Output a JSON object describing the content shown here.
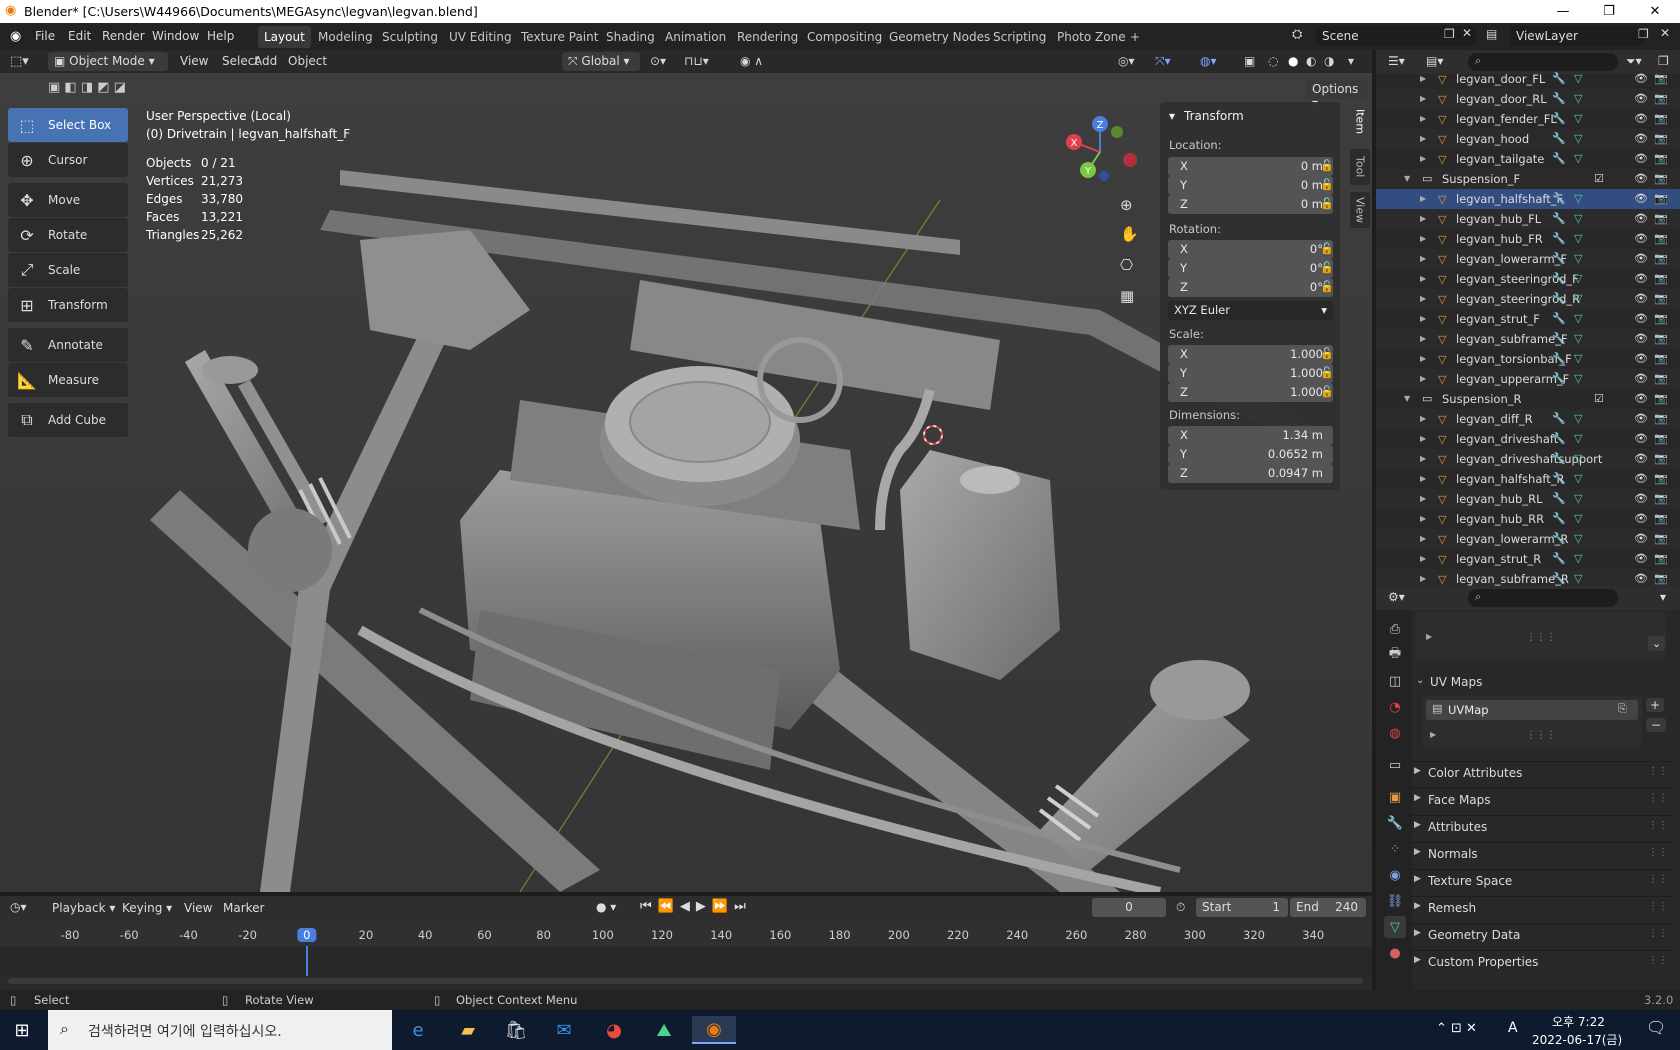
{
  "window": {
    "title": "Blender* [C:\\Users\\W44966\\Documents\\MEGAsync\\legvan\\legvan.blend]",
    "minimize": "—",
    "maximize": "❐",
    "close": "✕"
  },
  "menu": [
    "File",
    "Edit",
    "Render",
    "Window",
    "Help"
  ],
  "workspaces": [
    "Layout",
    "Modeling",
    "Sculpting",
    "UV Editing",
    "Texture Paint",
    "Shading",
    "Animation",
    "Rendering",
    "Compositing",
    "Geometry Nodes",
    "Scripting",
    "Photo Zone",
    "+"
  ],
  "active_workspace": "Layout",
  "scene": "Scene",
  "view_layer": "ViewLayer",
  "viewport_header": {
    "mode": "Object Mode",
    "menus": [
      "View",
      "Select",
      "Add",
      "Object"
    ],
    "orientation": "Global",
    "options": "Options"
  },
  "tools": [
    {
      "label": "Select Box",
      "icon": "select-box-icon",
      "glyph": "⬚",
      "active": true
    },
    {
      "label": "Cursor",
      "icon": "cursor-icon",
      "glyph": "⊕"
    },
    {
      "label": "Move",
      "icon": "move-icon",
      "glyph": "✥"
    },
    {
      "label": "Rotate",
      "icon": "rotate-icon",
      "glyph": "⟳"
    },
    {
      "label": "Scale",
      "icon": "scale-icon",
      "glyph": "⤢"
    },
    {
      "label": "Transform",
      "icon": "transform-icon",
      "glyph": "⊞"
    },
    {
      "label": "Annotate",
      "icon": "annotate-icon",
      "glyph": "✎"
    },
    {
      "label": "Measure",
      "icon": "measure-icon",
      "glyph": "📐"
    },
    {
      "label": "Add Cube",
      "icon": "add-cube-icon",
      "glyph": "⧉"
    }
  ],
  "overlay": {
    "perspective": "User Perspective (Local)",
    "context": "(0) Drivetrain | legvan_halfshaft_F",
    "stats": [
      {
        "label": "Objects",
        "value": "0 / 21"
      },
      {
        "label": "Vertices",
        "value": "21,273"
      },
      {
        "label": "Edges",
        "value": "33,780"
      },
      {
        "label": "Faces",
        "value": "13,221"
      },
      {
        "label": "Triangles",
        "value": "25,262"
      }
    ]
  },
  "transform_panel": {
    "title": "Transform",
    "location_label": "Location:",
    "location": [
      {
        "axis": "X",
        "value": "0 m"
      },
      {
        "axis": "Y",
        "value": "0 m"
      },
      {
        "axis": "Z",
        "value": "0 m"
      }
    ],
    "rotation_label": "Rotation:",
    "rotation": [
      {
        "axis": "X",
        "value": "0°"
      },
      {
        "axis": "Y",
        "value": "0°"
      },
      {
        "axis": "Z",
        "value": "0°"
      }
    ],
    "rotation_mode": "XYZ Euler",
    "scale_label": "Scale:",
    "scale": [
      {
        "axis": "X",
        "value": "1.000"
      },
      {
        "axis": "Y",
        "value": "1.000"
      },
      {
        "axis": "Z",
        "value": "1.000"
      }
    ],
    "dimensions_label": "Dimensions:",
    "dimensions": [
      {
        "axis": "X",
        "value": "1.34 m"
      },
      {
        "axis": "Y",
        "value": "0.0652 m"
      },
      {
        "axis": "Z",
        "value": "0.0947 m"
      }
    ]
  },
  "sidebar_tabs": [
    "Item",
    "Tool",
    "View"
  ],
  "gizmo": {
    "x": "X",
    "y": "Y",
    "z": "Z"
  },
  "outliner": [
    {
      "name": "legvan_door_FL",
      "type": "mesh"
    },
    {
      "name": "legvan_door_RL",
      "type": "mesh"
    },
    {
      "name": "legvan_fender_FL",
      "type": "mesh"
    },
    {
      "name": "legvan_hood",
      "type": "mesh"
    },
    {
      "name": "legvan_tailgate",
      "type": "mesh"
    },
    {
      "name": "Suspension_F",
      "type": "collection"
    },
    {
      "name": "legvan_halfshaft_F",
      "type": "mesh"
    },
    {
      "name": "legvan_hub_FL",
      "type": "mesh"
    },
    {
      "name": "legvan_hub_FR",
      "type": "mesh"
    },
    {
      "name": "legvan_lowerarm_F",
      "type": "mesh"
    },
    {
      "name": "legvan_steeringrod_F",
      "type": "mesh"
    },
    {
      "name": "legvan_steeringrod_R",
      "type": "mesh"
    },
    {
      "name": "legvan_strut_F",
      "type": "mesh"
    },
    {
      "name": "legvan_subframe_F",
      "type": "mesh"
    },
    {
      "name": "legvan_torsionbar_F",
      "type": "mesh"
    },
    {
      "name": "legvan_upperarm_F",
      "type": "mesh"
    },
    {
      "name": "Suspension_R",
      "type": "collection"
    },
    {
      "name": "legvan_diff_R",
      "type": "mesh"
    },
    {
      "name": "legvan_driveshaft",
      "type": "mesh"
    },
    {
      "name": "legvan_driveshaftsupport",
      "type": "mesh"
    },
    {
      "name": "legvan_halfshaft_R",
      "type": "mesh"
    },
    {
      "name": "legvan_hub_RL",
      "type": "mesh"
    },
    {
      "name": "legvan_hub_RR",
      "type": "mesh"
    },
    {
      "name": "legvan_lowerarm_R",
      "type": "mesh"
    },
    {
      "name": "legvan_strut_R",
      "type": "mesh"
    },
    {
      "name": "legvan_subframe_R",
      "type": "mesh"
    }
  ],
  "properties": {
    "uv_maps_title": "UV Maps",
    "uv_map": "UVMap",
    "sections": [
      "Color Attributes",
      "Face Maps",
      "Attributes",
      "Normals",
      "Texture Space",
      "Remesh",
      "Geometry Data",
      "Custom Properties"
    ]
  },
  "timeline": {
    "menus": [
      "Playback",
      "Keying",
      "View",
      "Marker"
    ],
    "current_frame": "0",
    "start_label": "Start",
    "start": "1",
    "end_label": "End",
    "end": "240",
    "ticks": [
      "-80",
      "-60",
      "-40",
      "-20",
      "0",
      "20",
      "40",
      "60",
      "80",
      "100",
      "120",
      "140",
      "160",
      "180",
      "200",
      "220",
      "240",
      "260",
      "280",
      "300",
      "320",
      "340"
    ]
  },
  "statusbar": {
    "select": "Select",
    "rotate": "Rotate View",
    "context": "Object Context Menu",
    "version": "3.2.0"
  },
  "taskbar": {
    "search_placeholder": "검색하려면 여기에 입력하십시오.",
    "time": "오후 7:22",
    "date": "2022-06-17(금)",
    "ime": "A"
  }
}
